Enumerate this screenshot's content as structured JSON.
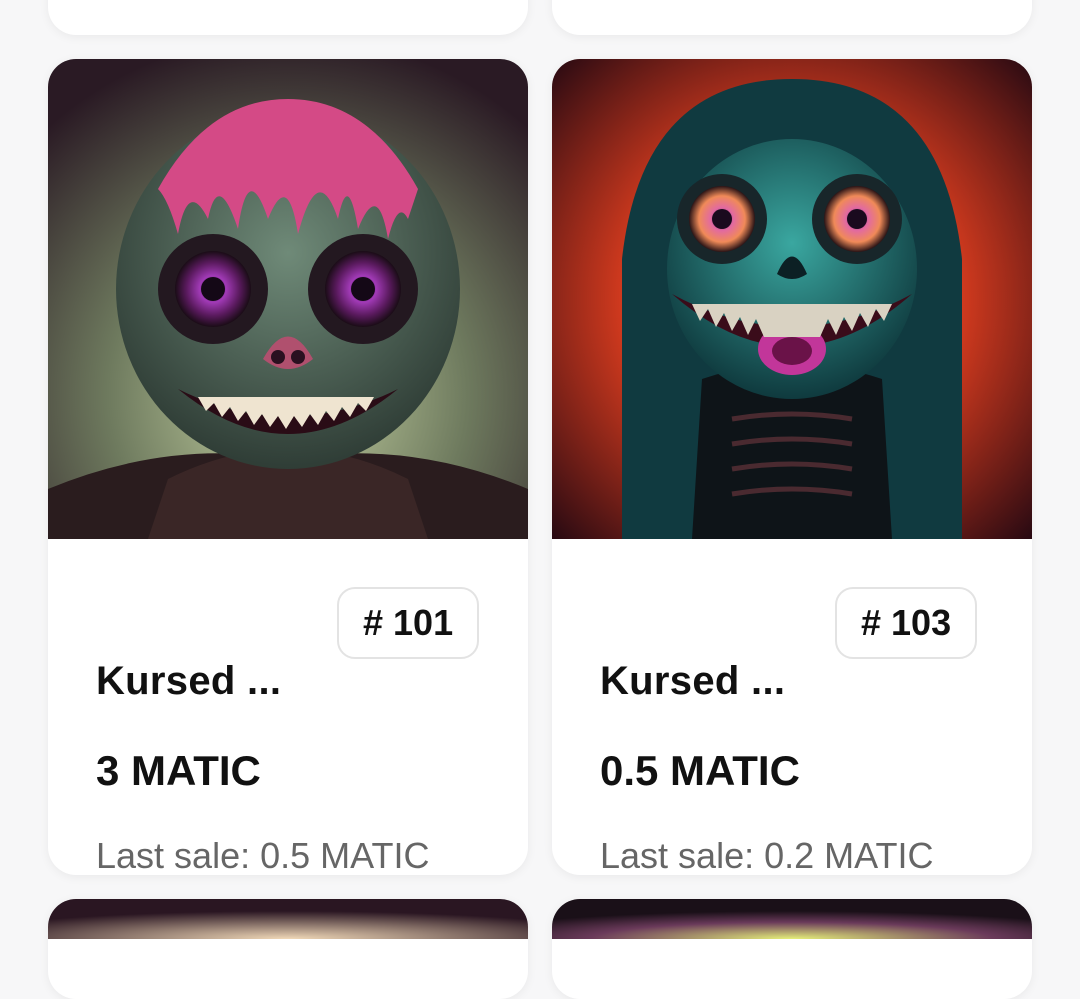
{
  "cards": [
    {
      "name": "Kursed ...",
      "token_id": "# 101",
      "price": "3 MATIC",
      "last_sale": "Last sale: 0.5 MATIC"
    },
    {
      "name": "Kursed ...",
      "token_id": "# 103",
      "price": "0.5 MATIC",
      "last_sale": "Last sale: 0.2 MATIC"
    }
  ]
}
